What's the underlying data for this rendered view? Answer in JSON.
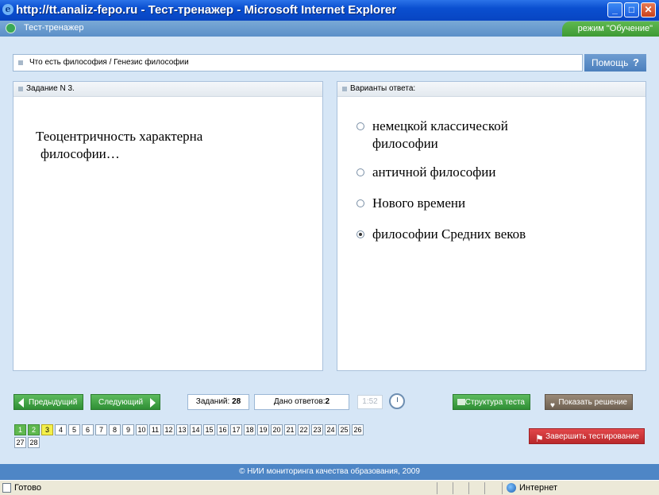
{
  "window": {
    "title": "http://tt.analiz-fepo.ru - Тест-тренажер - Microsoft Internet Explorer",
    "buttons": [
      "minimize",
      "maximize",
      "close"
    ]
  },
  "app": {
    "title": "Тест-тренажер",
    "mode_label": "режим \"Обучение\""
  },
  "breadcrumb": "Что есть философия / Генезис философии",
  "help_label": "Помощь",
  "task_panel": {
    "header": "Задание N 3.",
    "question_line1": "Теоцентричность характерна",
    "question_line2": "философии…"
  },
  "answers_panel": {
    "header": "Варианты ответа:",
    "options": [
      {
        "line1": "немецкой классической",
        "line2": "философии",
        "selected": false
      },
      {
        "line1": "античной философии",
        "line2": "",
        "selected": false
      },
      {
        "line1": "Нового времени",
        "line2": "",
        "selected": false
      },
      {
        "line1": "философии Средних веков",
        "line2": "",
        "selected": true
      }
    ]
  },
  "controls": {
    "prev_label": "Предыдущий",
    "next_label": "Следующий",
    "tasks_label": "Заданий:",
    "tasks_count": "28",
    "answered_label": "Дано ответов:",
    "answered_count": "2",
    "timer": "1:52",
    "structure_label": "Структура теста",
    "show_solution_label": "Показать решение",
    "finish_label": "Завершить тестирование"
  },
  "pages": {
    "numbers": [
      "1",
      "2",
      "3",
      "4",
      "5",
      "6",
      "7",
      "8",
      "9",
      "10",
      "11",
      "12",
      "13",
      "14",
      "15",
      "16",
      "17",
      "18",
      "19",
      "20",
      "21",
      "22",
      "23",
      "24",
      "25",
      "26",
      "27",
      "28"
    ],
    "done": [
      "1",
      "2"
    ],
    "current": "3"
  },
  "footer": "© НИИ мониторинга качества образования, 2009",
  "statusbar": {
    "ready": "Готово",
    "zone": "Интернет"
  },
  "colors": {
    "title_bar": "#0a4fd0",
    "accent_green": "#3e9a35",
    "finish_red": "#d9363a",
    "panel_bg": "#d6e6f6"
  }
}
